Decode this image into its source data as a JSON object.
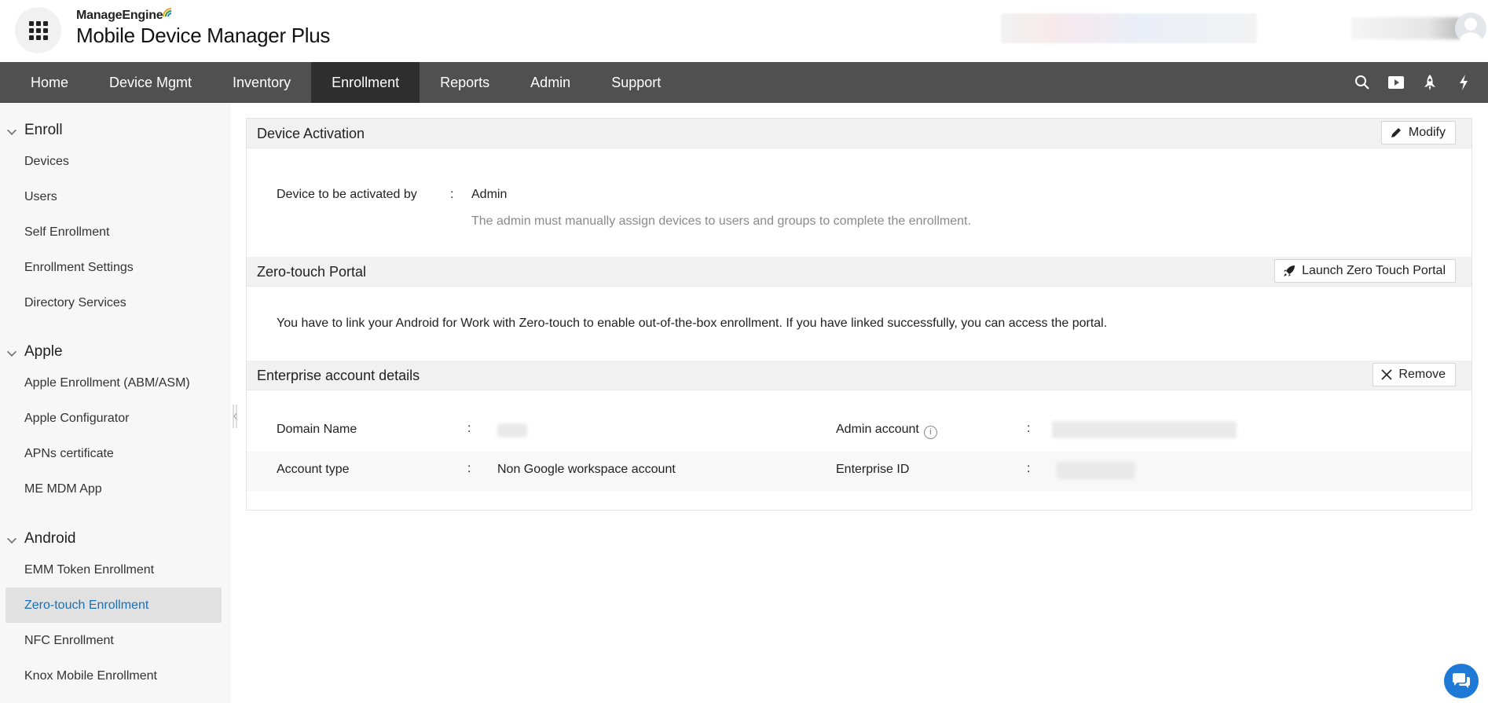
{
  "header": {
    "brand_company": "ManageEngine",
    "brand_product": "Mobile Device Manager Plus"
  },
  "nav": {
    "items": [
      {
        "label": "Home",
        "active": false
      },
      {
        "label": "Device Mgmt",
        "active": false
      },
      {
        "label": "Inventory",
        "active": false
      },
      {
        "label": "Enrollment",
        "active": true
      },
      {
        "label": "Reports",
        "active": false
      },
      {
        "label": "Admin",
        "active": false
      },
      {
        "label": "Support",
        "active": false
      }
    ],
    "icons": [
      "search-icon",
      "video-icon",
      "rocket-icon",
      "lightning-icon"
    ]
  },
  "sidebar": {
    "sections": [
      {
        "title": "Enroll",
        "items": [
          "Devices",
          "Users",
          "Self Enrollment",
          "Enrollment Settings",
          "Directory Services"
        ]
      },
      {
        "title": "Apple",
        "items": [
          "Apple Enrollment (ABM/ASM)",
          "Apple Configurator",
          "APNs certificate",
          "ME MDM App"
        ]
      },
      {
        "title": "Android",
        "items": [
          "EMM Token Enrollment",
          "Zero-touch Enrollment",
          "NFC Enrollment",
          "Knox Mobile Enrollment"
        ]
      }
    ],
    "active_item": "Zero-touch Enrollment"
  },
  "device_activation": {
    "title": "Device Activation",
    "modify_label": "Modify",
    "field_label": "Device to be activated by",
    "separator": ":",
    "field_value": "Admin",
    "description": "The admin must manually assign devices to users and groups to complete the enrollment."
  },
  "zero_touch": {
    "title": "Zero-touch Portal",
    "launch_label": "Launch Zero Touch Portal",
    "message": "You have to link your Android for Work with Zero-touch to enable out-of-the-box enrollment. If you have linked successfully, you can access the portal."
  },
  "enterprise": {
    "title": "Enterprise account details",
    "remove_label": "Remove",
    "domain_label": "Domain Name",
    "admin_label": "Admin account",
    "account_type_label": "Account type",
    "account_type_value": "Non Google workspace account",
    "enterprise_id_label": "Enterprise ID",
    "separator": ":",
    "info_glyph": "i"
  },
  "colors": {
    "nav_bg": "#505050",
    "nav_active": "#2e2e2e",
    "active_link": "#1a6fb5",
    "chat_fab": "#1e7ad6"
  }
}
